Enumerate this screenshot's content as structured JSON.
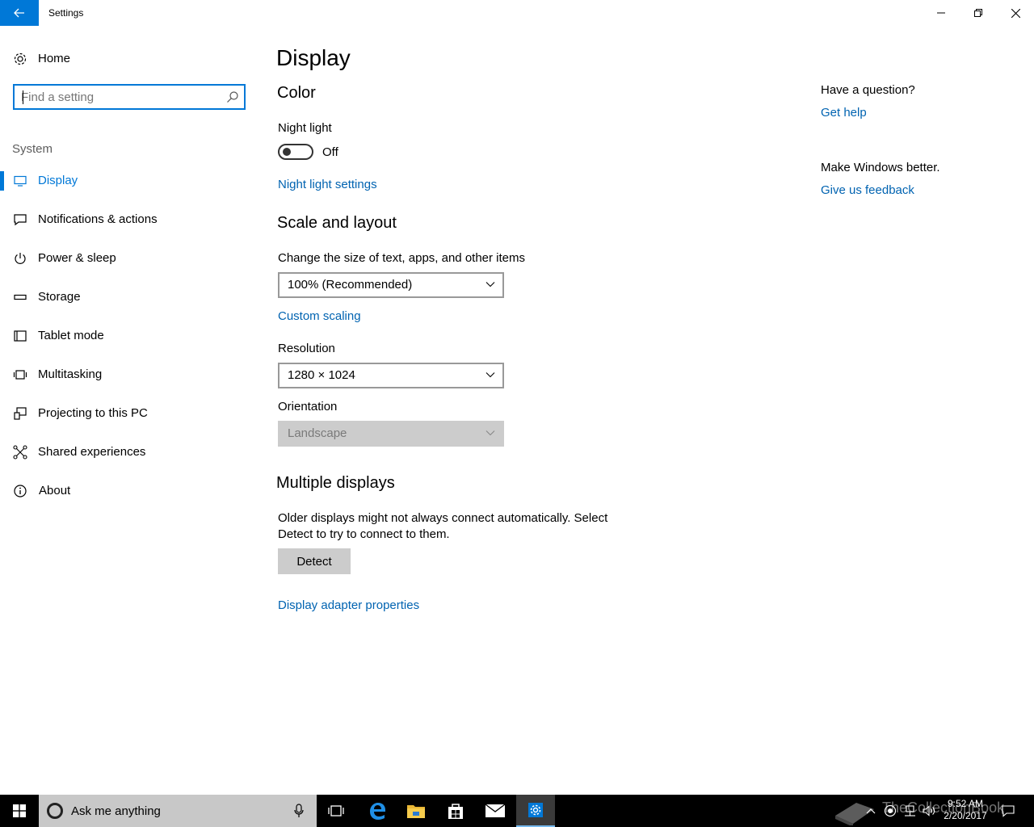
{
  "window": {
    "title": "Settings"
  },
  "sidebar": {
    "home_label": "Home",
    "search_placeholder": "Find a setting",
    "group_label": "System",
    "items": [
      {
        "label": "Display",
        "icon": "monitor-icon"
      },
      {
        "label": "Notifications & actions",
        "icon": "notification-icon"
      },
      {
        "label": "Power & sleep",
        "icon": "power-icon"
      },
      {
        "label": "Storage",
        "icon": "storage-icon"
      },
      {
        "label": "Tablet mode",
        "icon": "tablet-icon"
      },
      {
        "label": "Multitasking",
        "icon": "multitasking-icon"
      },
      {
        "label": "Projecting to this PC",
        "icon": "projecting-icon"
      },
      {
        "label": "Shared experiences",
        "icon": "shared-experiences-icon"
      },
      {
        "label": "About",
        "icon": "info-icon"
      }
    ],
    "active_item": "Display"
  },
  "main": {
    "page_title": "Display",
    "color": {
      "section_title": "Color",
      "night_light_label": "Night light",
      "night_light_state": "Off",
      "night_light_settings_link": "Night light settings"
    },
    "scale": {
      "section_title": "Scale and layout",
      "size_label": "Change the size of text, apps, and other items",
      "size_value": "100% (Recommended)",
      "custom_scaling_link": "Custom scaling",
      "resolution_label": "Resolution",
      "resolution_value": "1280 × 1024",
      "orientation_label": "Orientation",
      "orientation_value": "Landscape"
    },
    "multiple": {
      "section_title": "Multiple displays",
      "description": "Older displays might not always connect automatically. Select Detect to try to connect to them.",
      "detect_button": "Detect",
      "adapter_link": "Display adapter properties"
    }
  },
  "help": {
    "question": "Have a question?",
    "get_help_link": "Get help",
    "feedback_text": "Make Windows better.",
    "feedback_link": "Give us feedback"
  },
  "taskbar": {
    "search_text": "Ask me anything",
    "apps": [
      "task-view-icon",
      "edge-icon",
      "file-explorer-icon",
      "store-icon",
      "mail-icon",
      "settings-icon"
    ],
    "time": "9:52 AM",
    "date": "2/20/2017",
    "watermark": "TheCollectionBook"
  },
  "colors": {
    "accent": "#0078d7",
    "link": "#0063b1",
    "taskbar": "#000000"
  }
}
